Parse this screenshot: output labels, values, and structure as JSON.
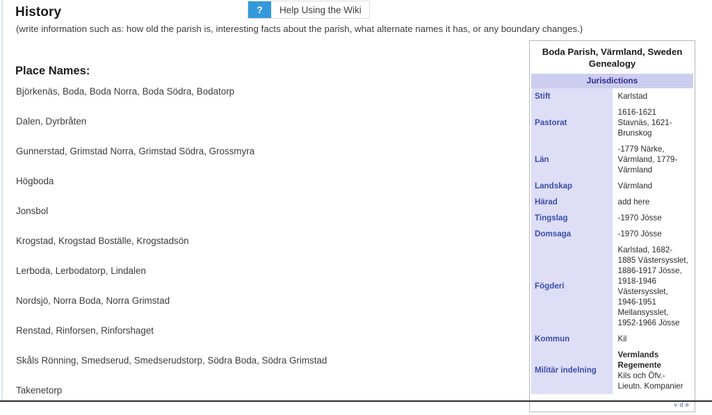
{
  "header": {
    "section_title": "History",
    "section_note": "(write information such as: how old the parish is, interesting facts about the parish, what alternate names it has, or any boundary changes.)",
    "help": {
      "icon_label": "?",
      "label": "Help Using the Wiki"
    }
  },
  "place_names": {
    "title": "Place Names:",
    "lines": [
      "Björkenäs, Boda, Boda Norra, Boda Södra, Bodatorp",
      "Dalen, Dyrbråten",
      "Gunnerstad, Grimstad Norra, Grimstad Södra, Grossmyra",
      "Högboda",
      "Jonsbol",
      "Krogstad, Krogstad Boställe, Krogstadsön",
      "Lerboda, Lerbodatorp, Lindalen",
      "Nordsjö, Norra Boda, Norra Grimstad",
      "Renstad, Rinforsen, Rinforshaget",
      "Skåls Rönning, Smedserud, Smedserudstorp, Södra Boda, Södra Grimstad",
      "Takenetorp"
    ]
  },
  "infobox": {
    "title": "Boda Parish, Värmland, Sweden Genealogy",
    "banner": "Jurisdictions",
    "rows": [
      {
        "label": "Stift",
        "value": "Karlstad"
      },
      {
        "label": "Pastorat",
        "value": "1616-1621 Stavnäs, 1621-Brunskog"
      },
      {
        "label": "Län",
        "value": "-1779 Närke, Värmland, 1779-Värmland"
      },
      {
        "label": "Landskap",
        "value": "Värmland"
      },
      {
        "label": "Härad",
        "value": "add here"
      },
      {
        "label": "Tingslag",
        "value": "-1970 Jösse"
      },
      {
        "label": "Domsaga",
        "value": "-1970 Jösse"
      },
      {
        "label": "Fögderi",
        "value": "Karlstad, 1682-1885 Västersysslet, 1886-1917 Jösse, 1918-1946 Västersysslet, 1946-1951 Mellansysslet, 1952-1966 Jösse"
      },
      {
        "label": "Kommun",
        "value": "Kil"
      },
      {
        "label": "Militär indelning",
        "value_strong": "Vermlands Regemente",
        "value_plain": "Kils och Öfv.- Lieutn. Kompanier"
      }
    ],
    "footer": {
      "view": "v",
      "discuss": "d",
      "edit": "e",
      "separator": "·"
    }
  },
  "colors": {
    "accent_blue": "#3499db",
    "banner_lavender": "#cdcdf0",
    "label_lavender": "#dedef7",
    "link_blue": "#3b4ea8"
  }
}
